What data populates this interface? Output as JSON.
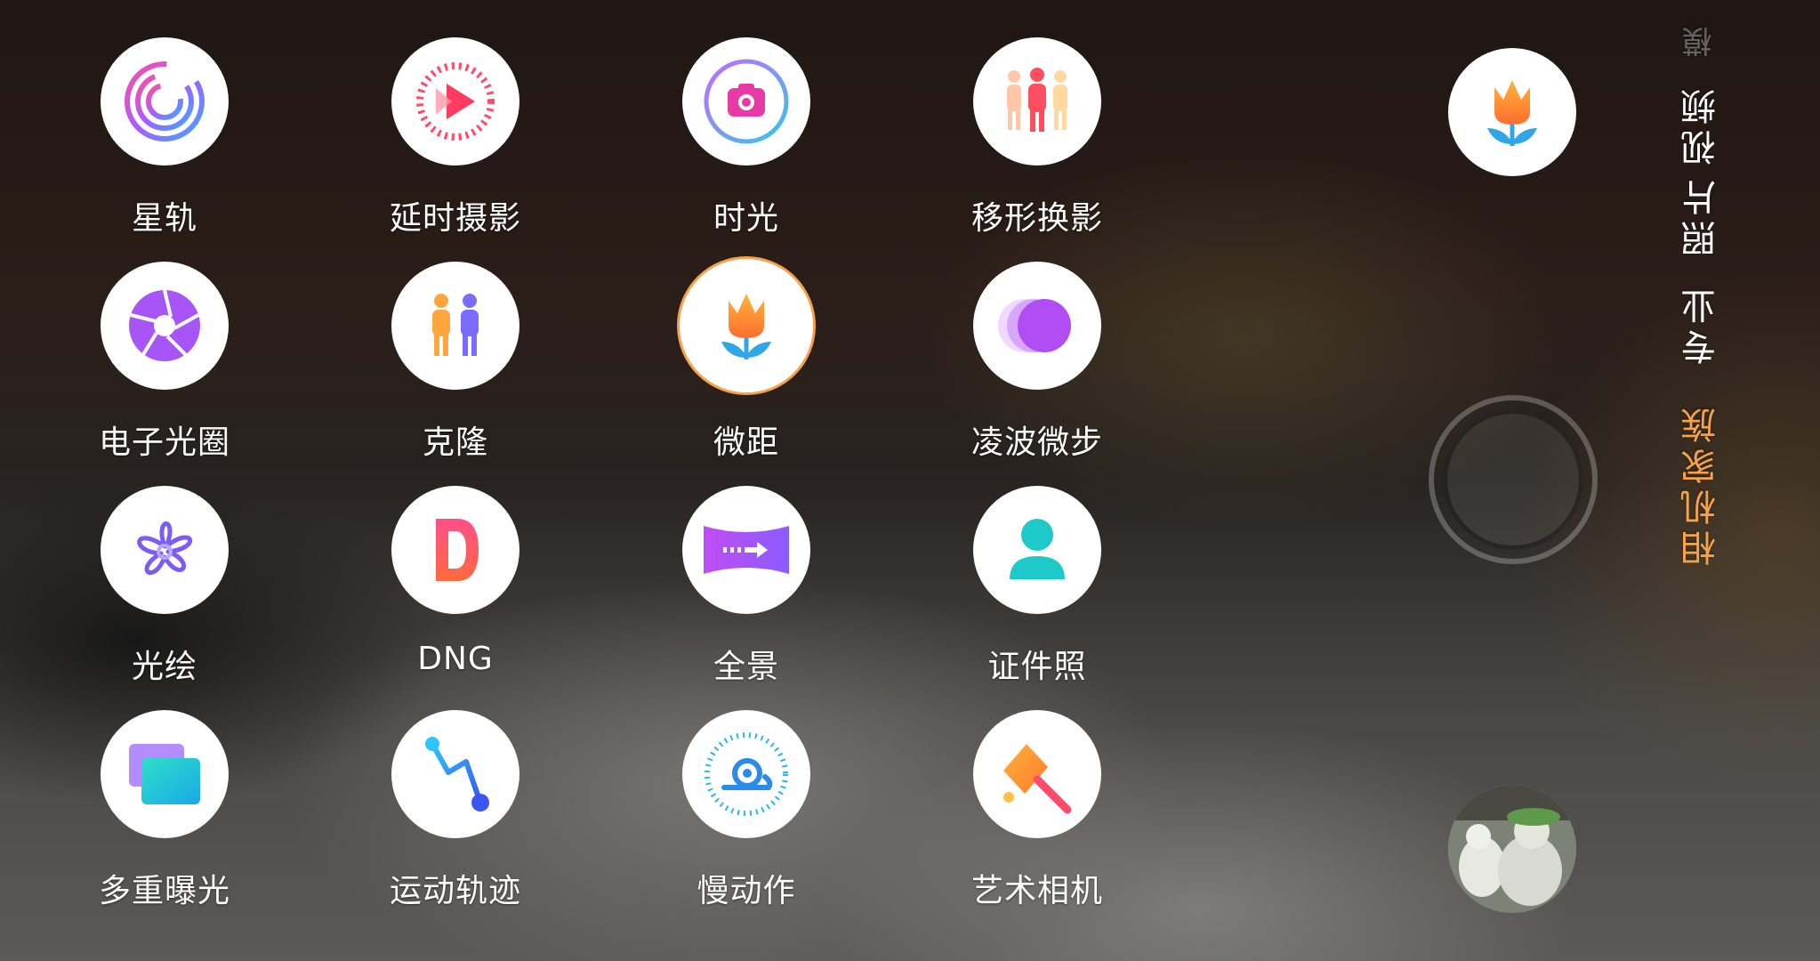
{
  "modes": [
    {
      "label": "星轨",
      "icon": "star-trail-icon",
      "selected": false
    },
    {
      "label": "延时摄影",
      "icon": "timelapse-icon",
      "selected": false
    },
    {
      "label": "时光",
      "icon": "time-camera-icon",
      "selected": false
    },
    {
      "label": "移形换影",
      "icon": "people-shift-icon",
      "selected": false
    },
    {
      "label": "电子光圈",
      "icon": "aperture-icon",
      "selected": false
    },
    {
      "label": "克隆",
      "icon": "clone-icon",
      "selected": false
    },
    {
      "label": "微距",
      "icon": "macro-tulip-icon",
      "selected": true
    },
    {
      "label": "凌波微步",
      "icon": "ripple-step-icon",
      "selected": false
    },
    {
      "label": "光绘",
      "icon": "light-painting-icon",
      "selected": false
    },
    {
      "label": "DNG",
      "icon": "dng-icon",
      "selected": false
    },
    {
      "label": "全景",
      "icon": "panorama-icon",
      "selected": false
    },
    {
      "label": "证件照",
      "icon": "id-photo-icon",
      "selected": false
    },
    {
      "label": "多重曝光",
      "icon": "multi-exposure-icon",
      "selected": false
    },
    {
      "label": "运动轨迹",
      "icon": "motion-track-icon",
      "selected": false
    },
    {
      "label": "慢动作",
      "icon": "slow-motion-icon",
      "selected": false
    },
    {
      "label": "艺术相机",
      "icon": "art-camera-icon",
      "selected": false
    }
  ],
  "side_tabs": {
    "top_faded": "模",
    "video": "视频",
    "photo": "照片",
    "pro": "专业",
    "family": "相机家族"
  },
  "colors": {
    "accent": "#f5a24a",
    "circle": "#ffffff"
  }
}
